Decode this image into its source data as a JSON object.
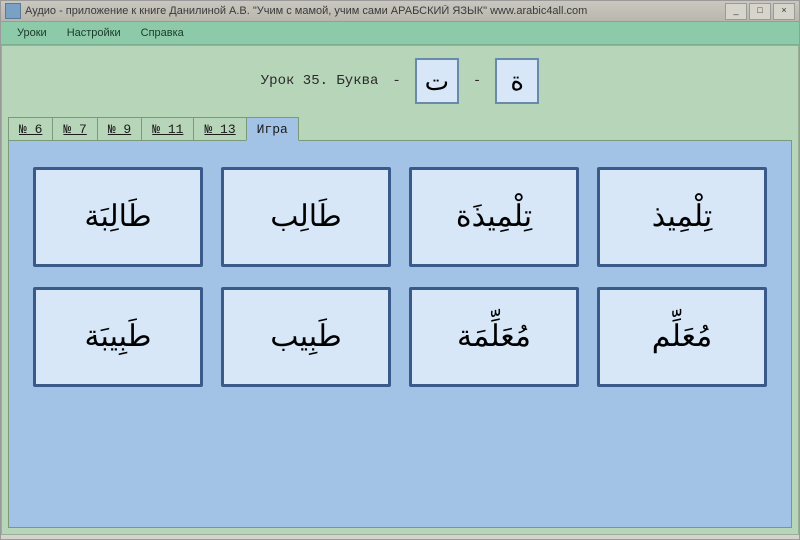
{
  "window": {
    "title": "Аудио - приложение к книге   Данилиной А.В.  \"Учим с мамой, учим сами АРАБСКИЙ ЯЗЫК\"      www.arabic4all.com",
    "min": "_",
    "max": "□",
    "close": "×"
  },
  "menu": {
    "lessons": "Уроки",
    "settings": "Настройки",
    "help": "Справка"
  },
  "lesson": {
    "title": "Урок 35. Буква",
    "dash": "-",
    "letter1": "ت",
    "letter2": "ة"
  },
  "tabs": [
    {
      "label": "№ 6"
    },
    {
      "label": "№ 7"
    },
    {
      "label": "№ 9"
    },
    {
      "label": "№ 11"
    },
    {
      "label": "№ 13"
    },
    {
      "label": "Игра"
    }
  ],
  "words": [
    "طَالِبَة",
    "طَالِب",
    "تِلْمِيذَة",
    "تِلْمِيذ",
    "طَبِيبَة",
    "طَبِيب",
    "مُعَلِّمَة",
    "مُعَلِّم"
  ]
}
